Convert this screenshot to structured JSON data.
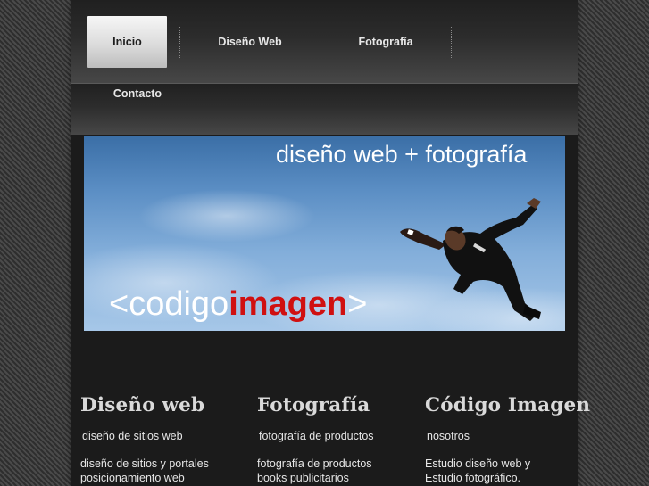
{
  "nav": {
    "items": [
      {
        "label": "Inicio",
        "active": true
      },
      {
        "label": "Diseño Web"
      },
      {
        "label": "Fotografía"
      },
      {
        "label": "Contacto"
      }
    ]
  },
  "banner": {
    "tagline": "diseño web + fotografía",
    "logo": {
      "open": "<",
      "part1": "codigo",
      "part2": "imagen",
      "close": ">"
    }
  },
  "columns": [
    {
      "title": "Diseño web",
      "subtitle": "diseño de sitios web",
      "lines": [
        "diseño de sitios y portales",
        "posicionamiento web"
      ]
    },
    {
      "title": "Fotografía",
      "subtitle": "fotografía de productos",
      "lines": [
        "fotografía de productos",
        "books publicitarios"
      ]
    },
    {
      "title": "Código Imagen",
      "subtitle": "nosotros",
      "lines": [
        "Estudio diseño web y",
        "Estudio fotográfico."
      ]
    }
  ],
  "colors": {
    "logo_accent": "#d01010",
    "page_background": "#1b1b1b",
    "active_tab": "#e6e6e6"
  }
}
